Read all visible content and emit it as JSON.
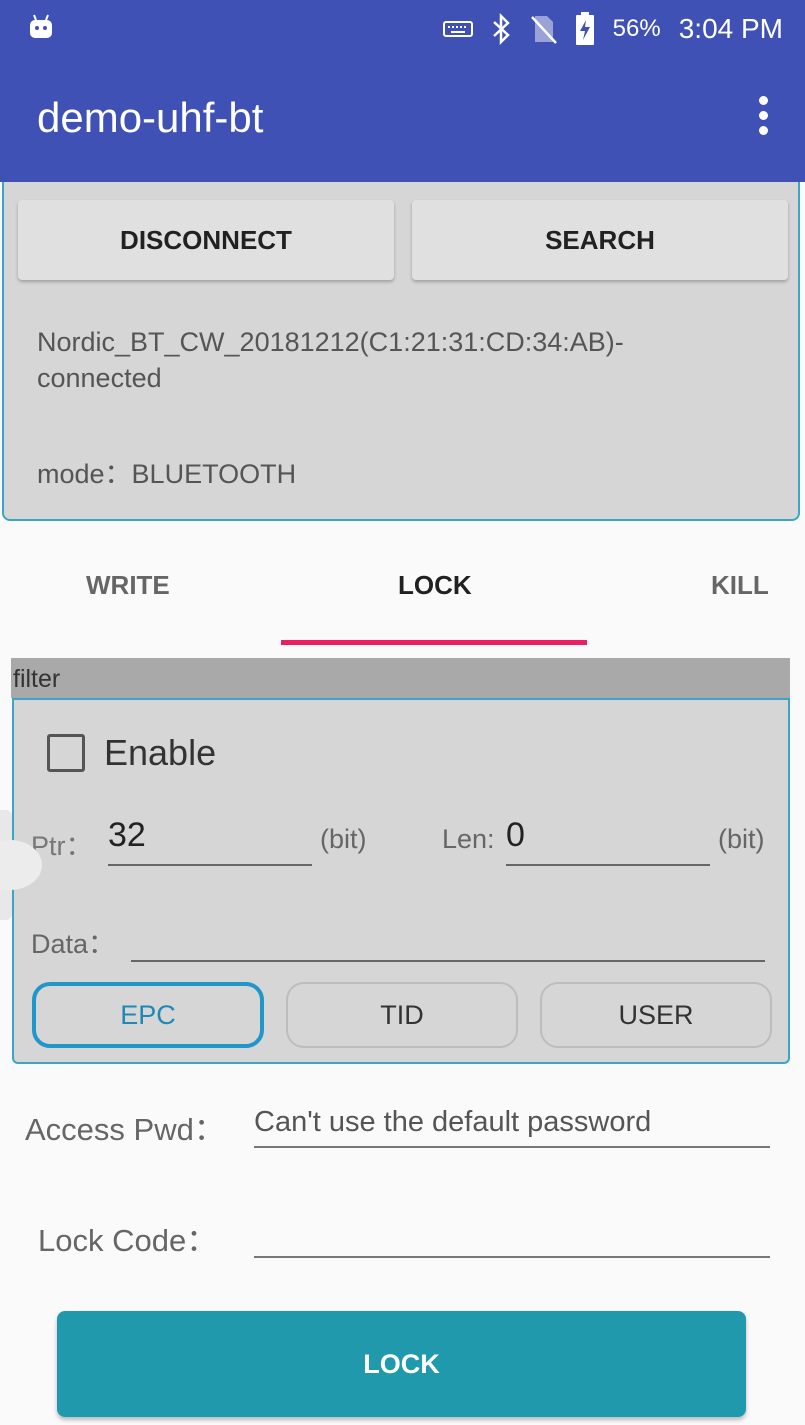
{
  "status_bar": {
    "left_icon": "android-debug-icon",
    "icons": [
      "keyboard-icon",
      "bluetooth-icon",
      "no-sim-icon",
      "battery-charging-icon"
    ],
    "battery": "56%",
    "time": "3:04 PM"
  },
  "app_bar": {
    "title": "demo-uhf-bt",
    "overflow_icon": "more-vert-icon",
    "color": "#3f51b5"
  },
  "connection": {
    "disconnect_label": "DISCONNECT",
    "search_label": "SEARCH",
    "device_status": "Nordic_BT_CW_20181212(C1:21:31:CD:34:AB)-connected",
    "mode": "mode：BLUETOOTH"
  },
  "tabs": [
    {
      "label": "WRITE",
      "active": false
    },
    {
      "label": "LOCK",
      "active": true
    },
    {
      "label": "KILL",
      "active": false
    }
  ],
  "tab_indicator_color": "#e91e63",
  "filter": {
    "header": "filter",
    "enable_label": "Enable",
    "enable_checked": false,
    "ptr_label": "Ptr：",
    "ptr_value": "32",
    "ptr_unit": "(bit)",
    "len_label": "Len:",
    "len_value": "0",
    "len_unit": "(bit)",
    "data_label": "Data：",
    "data_value": "",
    "banks": [
      "EPC",
      "TID",
      "USER"
    ],
    "selected_bank": "EPC"
  },
  "lock_form": {
    "access_pwd_label": "Access Pwd：",
    "access_pwd_placeholder": "Can't use the default password",
    "lock_code_label": "Lock Code：",
    "lock_code_value": "",
    "lock_button": "LOCK",
    "lock_button_color": "#2199ad"
  }
}
